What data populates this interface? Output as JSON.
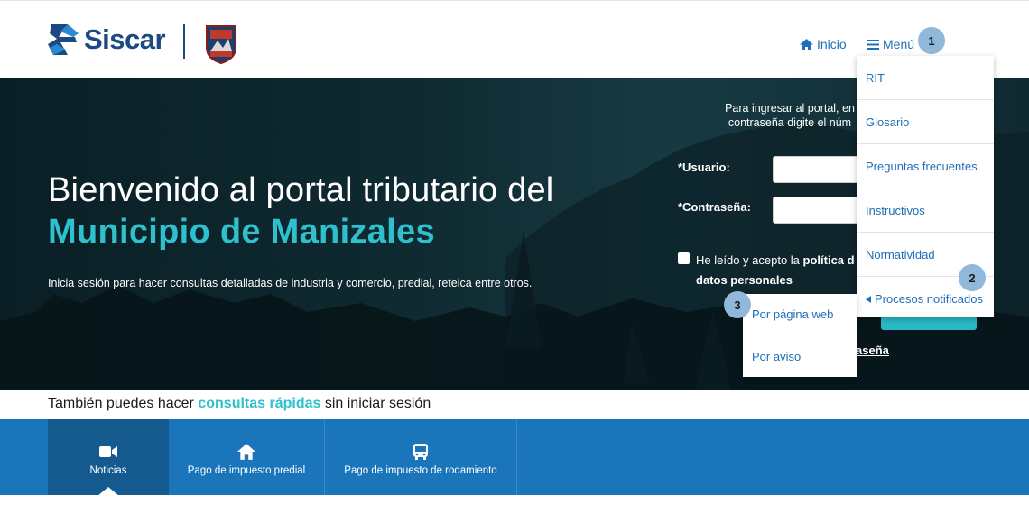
{
  "header": {
    "logo_text": "Siscar",
    "nav": {
      "inicio": "Inicio",
      "menu": "Menú"
    }
  },
  "markers": {
    "m1": "1",
    "m2": "2",
    "m3": "3"
  },
  "hero": {
    "title_line1": "Bienvenido al portal tributario del",
    "title_line2": "Municipio de Manizales",
    "subtitle": "Inicia sesión para hacer consultas detalladas de industria y comercio, predial, reteica entre otros."
  },
  "login": {
    "hint_line1": "Para ingresar al portal, en",
    "hint_line2": "contraseña digite el núm",
    "user_label": "*Usuario:",
    "pass_label": "*Contraseña:",
    "checkbox_text_pre": "He leído y acepto la",
    "checkbox_text_bold": "política d",
    "checkbox_text_line2": "datos personales",
    "forgot": "aseña"
  },
  "dropdown": {
    "items": [
      {
        "label": "RIT"
      },
      {
        "label": "Glosario"
      },
      {
        "label": "Preguntas frecuentes"
      },
      {
        "label": "Instructivos"
      },
      {
        "label": "Normatividad"
      },
      {
        "label": "Procesos notificados"
      }
    ],
    "submenu": [
      {
        "label": "Por página web"
      },
      {
        "label": "Por aviso"
      }
    ]
  },
  "quick": {
    "pre": "También puedes hacer",
    "highlight": "consultas rápidas",
    "post": "sin iniciar sesión"
  },
  "tabs": [
    {
      "label": "Noticias",
      "icon": "video-camera-icon"
    },
    {
      "label": "Pago de impuesto predial",
      "icon": "home-icon"
    },
    {
      "label": "Pago de impuesto de rodamiento",
      "icon": "bus-icon"
    }
  ],
  "colors": {
    "brand_blue": "#1b4a82",
    "link_blue": "#1e6fb8",
    "teal": "#2ec0cc",
    "bar_blue": "#1a75bb"
  }
}
